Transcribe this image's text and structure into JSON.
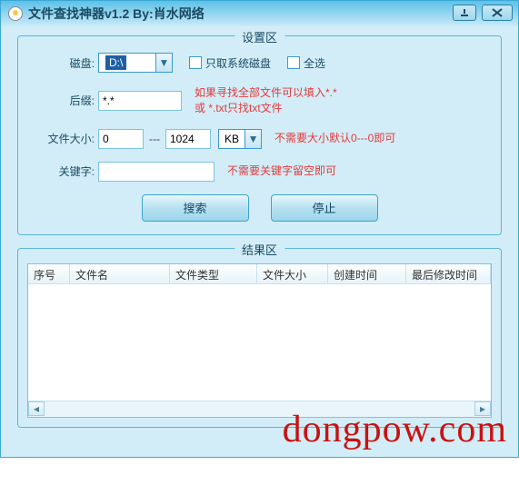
{
  "window": {
    "title": "文件查找神器v1.2  By:肖水网络"
  },
  "settings": {
    "legend": "设置区",
    "disk_label": "磁盘:",
    "disk_value": "D:\\",
    "cb_system_label": "只取系统磁盘",
    "cb_all_label": "全选",
    "suffix_label": "后缀:",
    "suffix_value": "*.*",
    "suffix_hint": "如果寻找全部文件可以填入*.*\n或 *.txt只找txt文件",
    "size_label": "文件大小:",
    "size_min": "0",
    "size_max": "1024",
    "size_dash": "---",
    "size_unit": "KB",
    "size_hint": "不需要大小默认0---0即可",
    "keyword_label": "关键字:",
    "keyword_value": "",
    "keyword_hint": "不需要关键字留空即可",
    "btn_search": "搜索",
    "btn_stop": "停止"
  },
  "results": {
    "legend": "结果区",
    "columns": {
      "seq": "序号",
      "name": "文件名",
      "type": "文件类型",
      "size": "文件大小",
      "ctime": "创建时间",
      "mtime": "最后修改时间"
    }
  },
  "watermark": "dongpow.com"
}
